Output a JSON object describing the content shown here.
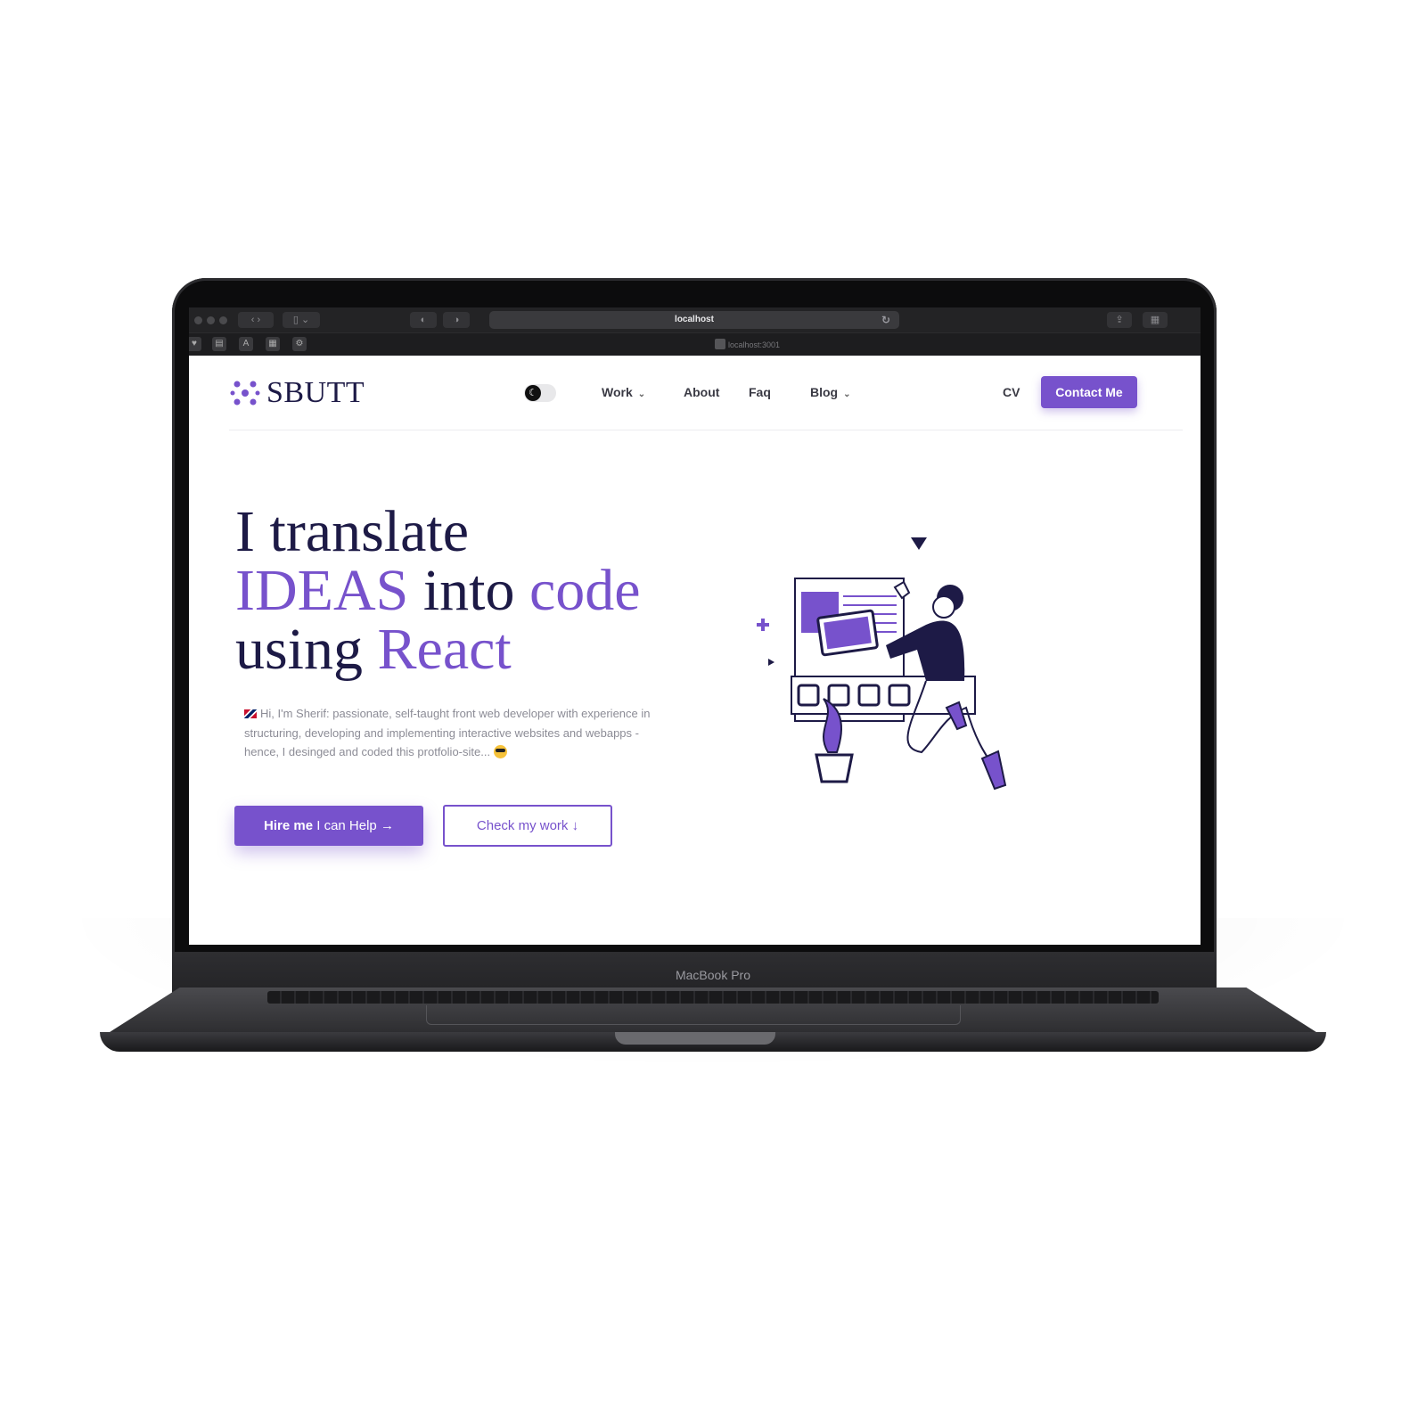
{
  "device": {
    "label": "MacBook Pro"
  },
  "browser": {
    "url": "localhost",
    "tab_title": "localhost:3001"
  },
  "nav": {
    "logo_text": "SBUTT",
    "items": [
      {
        "label": "Work",
        "has_dropdown": true
      },
      {
        "label": "About",
        "has_dropdown": false
      },
      {
        "label": "Faq",
        "has_dropdown": false
      },
      {
        "label": "Blog",
        "has_dropdown": true
      }
    ],
    "cv_label": "CV",
    "contact_label": "Contact Me"
  },
  "hero": {
    "line1": "I translate",
    "line2_accent": "IDEAS",
    "line2_mid": "into",
    "line2_end": "code",
    "line3_start": "using",
    "line3_accent": "React",
    "description": "Hi, I'm Sherif: passionate, self-taught front web developer with experience in structuring, developing and implementing interactive websites and webapps - hence, I desinged and coded this protfolio-site...",
    "hire_bold": "Hire me",
    "hire_rest": "I can Help →",
    "check_work": "Check my work ↓"
  },
  "colors": {
    "accent": "#7752cc",
    "dark": "#1d1a46",
    "muted_text": "#8c8c96"
  }
}
